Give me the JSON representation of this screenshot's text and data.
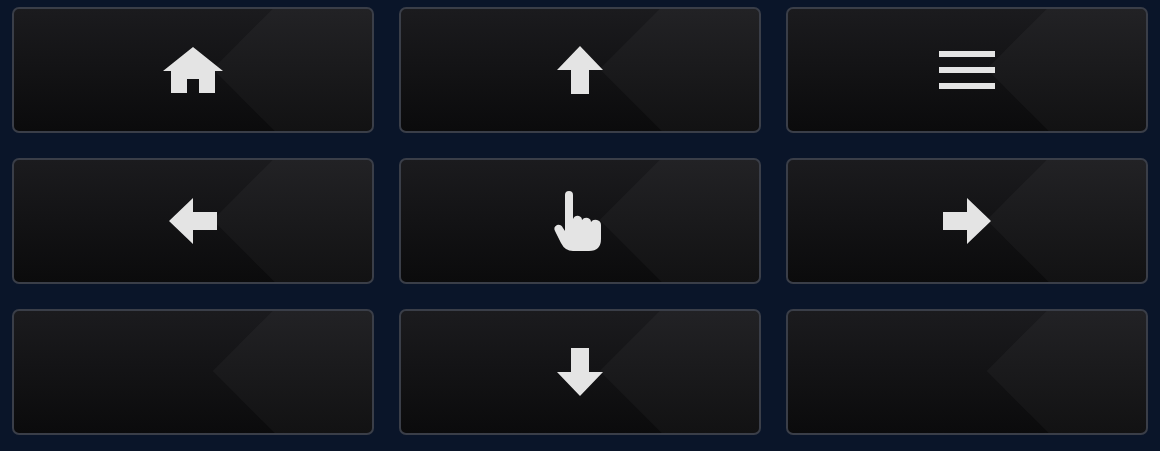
{
  "buttons": [
    {
      "kind": "home"
    },
    {
      "kind": "up"
    },
    {
      "kind": "menu"
    },
    {
      "kind": "left"
    },
    {
      "kind": "touch"
    },
    {
      "kind": "right"
    },
    {
      "kind": "blank"
    },
    {
      "kind": "down"
    },
    {
      "kind": "blank"
    }
  ]
}
